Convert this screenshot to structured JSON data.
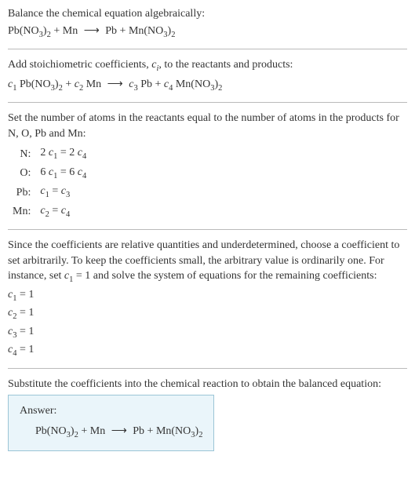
{
  "intro": {
    "line1": "Balance the chemical equation algebraically:",
    "eq_lhs1": "Pb(NO",
    "eq_sub1": "3",
    "eq_rhs1": ")",
    "eq_sub2": "2",
    "eq_plus1": " + Mn",
    "arrow": " ⟶ ",
    "eq_r1": "Pb + Mn(NO",
    "eq_rsub1": "3",
    "eq_r2": ")",
    "eq_rsub2": "2"
  },
  "step1": {
    "text1": "Add stoichiometric coefficients, ",
    "ci": "c",
    "ci_sub": "i",
    "text2": ", to the reactants and products:",
    "c1": "c",
    "c1s": "1",
    "sp1": " Pb(NO",
    "sp1s1": "3",
    "sp1b": ")",
    "sp1s2": "2",
    "plus1": " + ",
    "c2": "c",
    "c2s": "2",
    "sp2": " Mn",
    "arrow": " ⟶ ",
    "c3": "c",
    "c3s": "3",
    "sp3": " Pb + ",
    "c4": "c",
    "c4s": "4",
    "sp4": " Mn(NO",
    "sp4s1": "3",
    "sp4b": ")",
    "sp4s2": "2"
  },
  "step2": {
    "text": "Set the number of atoms in the reactants equal to the number of atoms in the products for N, O, Pb and Mn:",
    "rows": {
      "n": {
        "label": "N:",
        "lhs_coef": "2 ",
        "lhs_c": "c",
        "lhs_s": "1",
        "eq": " = ",
        "rhs_coef": "2 ",
        "rhs_c": "c",
        "rhs_s": "4"
      },
      "o": {
        "label": "O:",
        "lhs_coef": "6 ",
        "lhs_c": "c",
        "lhs_s": "1",
        "eq": " = ",
        "rhs_coef": "6 ",
        "rhs_c": "c",
        "rhs_s": "4"
      },
      "pb": {
        "label": "Pb:",
        "lhs_coef": "",
        "lhs_c": "c",
        "lhs_s": "1",
        "eq": " = ",
        "rhs_coef": "",
        "rhs_c": "c",
        "rhs_s": "3"
      },
      "mn": {
        "label": "Mn:",
        "lhs_coef": "",
        "lhs_c": "c",
        "lhs_s": "2",
        "eq": " = ",
        "rhs_coef": "",
        "rhs_c": "c",
        "rhs_s": "4"
      }
    }
  },
  "step3": {
    "text1": "Since the coefficients are relative quantities and underdetermined, choose a coefficient to set arbitrarily. To keep the coefficients small, the arbitrary value is ordinarily one. For instance, set ",
    "c": "c",
    "cs": "1",
    "text2": " = 1 and solve the system of equations for the remaining coefficients:",
    "lines": {
      "l1": {
        "c": "c",
        "s": "1",
        "eq": " = 1"
      },
      "l2": {
        "c": "c",
        "s": "2",
        "eq": " = 1"
      },
      "l3": {
        "c": "c",
        "s": "3",
        "eq": " = 1"
      },
      "l4": {
        "c": "c",
        "s": "4",
        "eq": " = 1"
      }
    }
  },
  "step4": {
    "text": "Substitute the coefficients into the chemical reaction to obtain the balanced equation:"
  },
  "answer": {
    "label": "Answer:",
    "lhs1": "Pb(NO",
    "sub1": "3",
    "lhs2": ")",
    "sub2": "2",
    "plus": " + Mn",
    "arrow": " ⟶ ",
    "rhs1": "Pb + Mn(NO",
    "rsub1": "3",
    "rhs2": ")",
    "rsub2": "2"
  }
}
